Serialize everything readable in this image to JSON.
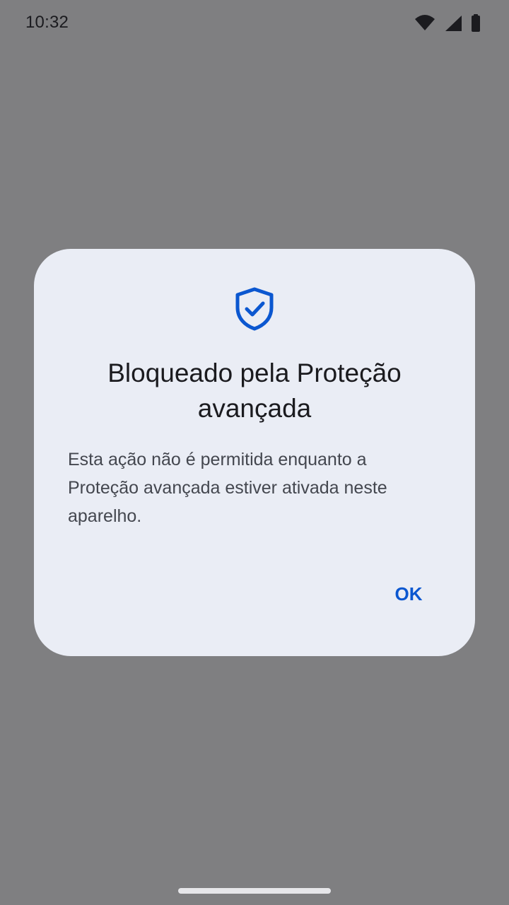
{
  "status_bar": {
    "time": "10:32",
    "icons": [
      "wifi-icon",
      "cellular-signal-icon",
      "battery-icon"
    ]
  },
  "dialog": {
    "icon": "shield-check-icon",
    "title": "Bloqueado pela Proteção\navançada",
    "body": "Esta ação não é permitida enquanto a\nProteção avançada estiver ativada neste\naparelho.",
    "ok_label": "OK"
  },
  "colors": {
    "scrim": "#7f7f81",
    "dialog_surface": "#eaedf5",
    "accent": "#0b57d0",
    "title_text": "#1b1b1f",
    "body_text": "#44474f"
  }
}
